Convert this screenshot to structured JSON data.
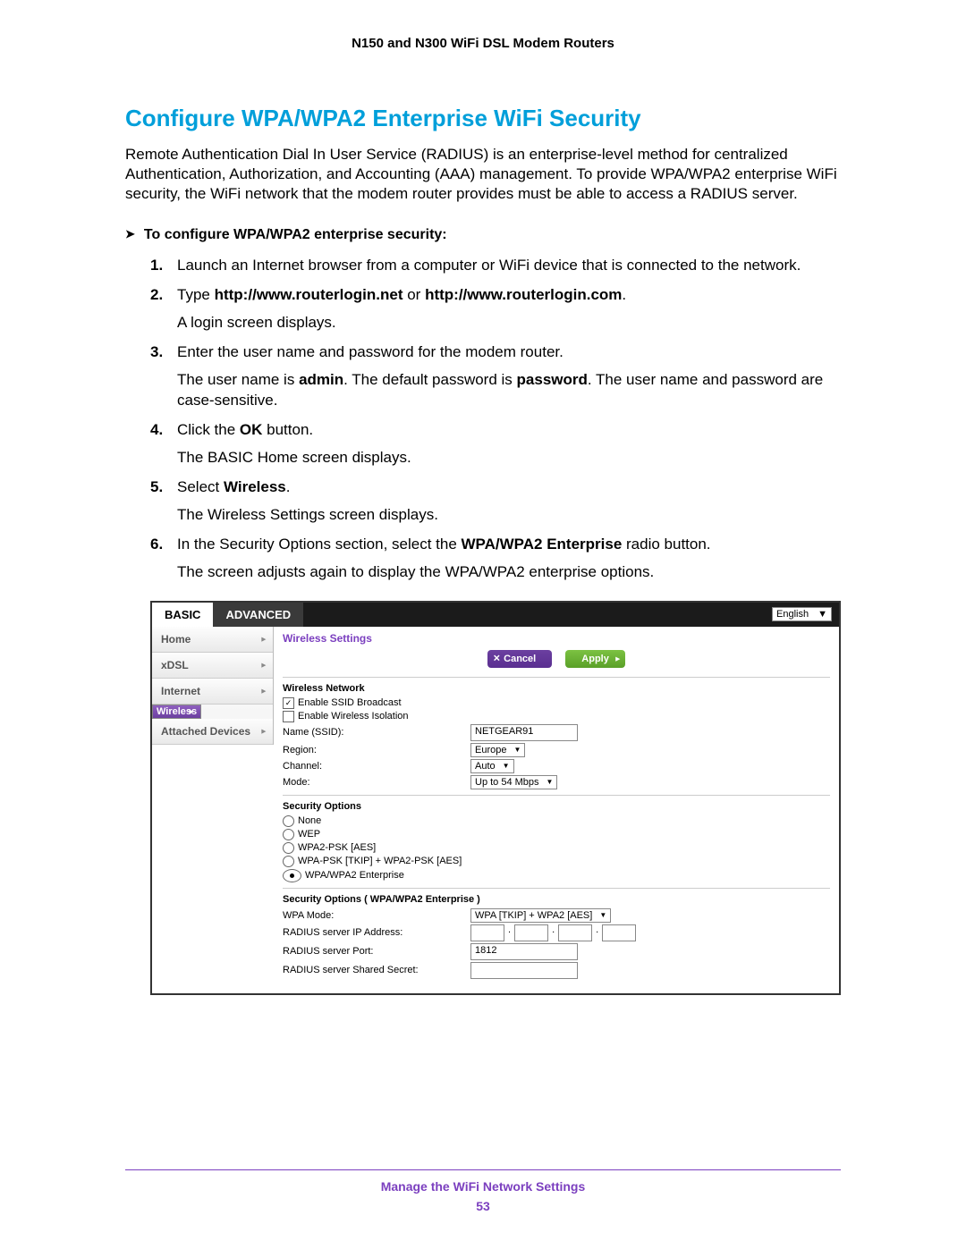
{
  "header": "N150 and N300 WiFi DSL Modem Routers",
  "title": "Configure WPA/WPA2 Enterprise WiFi Security",
  "intro": "Remote Authentication Dial In User Service (RADIUS) is an enterprise-level method for centralized Authentication, Authorization, and Accounting (AAA) management. To provide WPA/WPA2 enterprise WiFi security, the WiFi network that the modem router provides must be able to access a RADIUS server.",
  "task": "To configure WPA/WPA2 enterprise security:",
  "steps": {
    "s1": {
      "n": "1.",
      "a": "Launch an Internet browser from a computer or WiFi device that is connected to the network."
    },
    "s2": {
      "n": "2.",
      "a": "Type ",
      "b": "http://www.routerlogin.net",
      "c": " or ",
      "d": "http://www.routerlogin.com",
      "e": ".",
      "f": "A login screen displays."
    },
    "s3": {
      "n": "3.",
      "a": "Enter the user name and password for the modem router.",
      "b1": "The user name is ",
      "b2": "admin",
      "b3": ". The default password is ",
      "b4": "password",
      "b5": ". The user name and password are case-sensitive."
    },
    "s4": {
      "n": "4.",
      "a": "Click the ",
      "b": "OK",
      "c": " button.",
      "d": "The BASIC Home screen displays."
    },
    "s5": {
      "n": "5.",
      "a": "Select ",
      "b": "Wireless",
      "c": ".",
      "d": "The Wireless Settings screen displays."
    },
    "s6": {
      "n": "6.",
      "a": "In the Security Options section, select the ",
      "b": "WPA/WPA2 Enterprise",
      "c": " radio button.",
      "d": "The screen adjusts again to display the WPA/WPA2 enterprise options."
    }
  },
  "ui": {
    "tabs": {
      "basic": "BASIC",
      "advanced": "ADVANCED"
    },
    "language": "English",
    "sidebar": [
      "Home",
      "xDSL",
      "Internet",
      "Wireless",
      "Attached Devices"
    ],
    "panel_title": "Wireless Settings",
    "buttons": {
      "cancel": "Cancel",
      "apply": "Apply"
    },
    "net": {
      "section": "Wireless Network",
      "ssid_broadcast": "Enable SSID Broadcast",
      "isolation": "Enable Wireless Isolation",
      "name_lbl": "Name (SSID):",
      "name_val": "NETGEAR91",
      "region_lbl": "Region:",
      "region_val": "Europe",
      "channel_lbl": "Channel:",
      "channel_val": "Auto",
      "mode_lbl": "Mode:",
      "mode_val": "Up to 54 Mbps"
    },
    "sec": {
      "section": "Security Options",
      "o1": "None",
      "o2": "WEP",
      "o3": "WPA2-PSK [AES]",
      "o4": "WPA-PSK [TKIP] + WPA2-PSK [AES]",
      "o5": "WPA/WPA2 Enterprise"
    },
    "ent": {
      "section": "Security Options ( WPA/WPA2 Enterprise )",
      "mode_lbl": "WPA Mode:",
      "mode_val": "WPA [TKIP] + WPA2 [AES]",
      "ip_lbl": "RADIUS server IP Address:",
      "port_lbl": "RADIUS server Port:",
      "port_val": "1812",
      "secret_lbl": "RADIUS server Shared Secret:"
    }
  },
  "footer": {
    "text": "Manage the WiFi Network Settings",
    "page": "53"
  }
}
